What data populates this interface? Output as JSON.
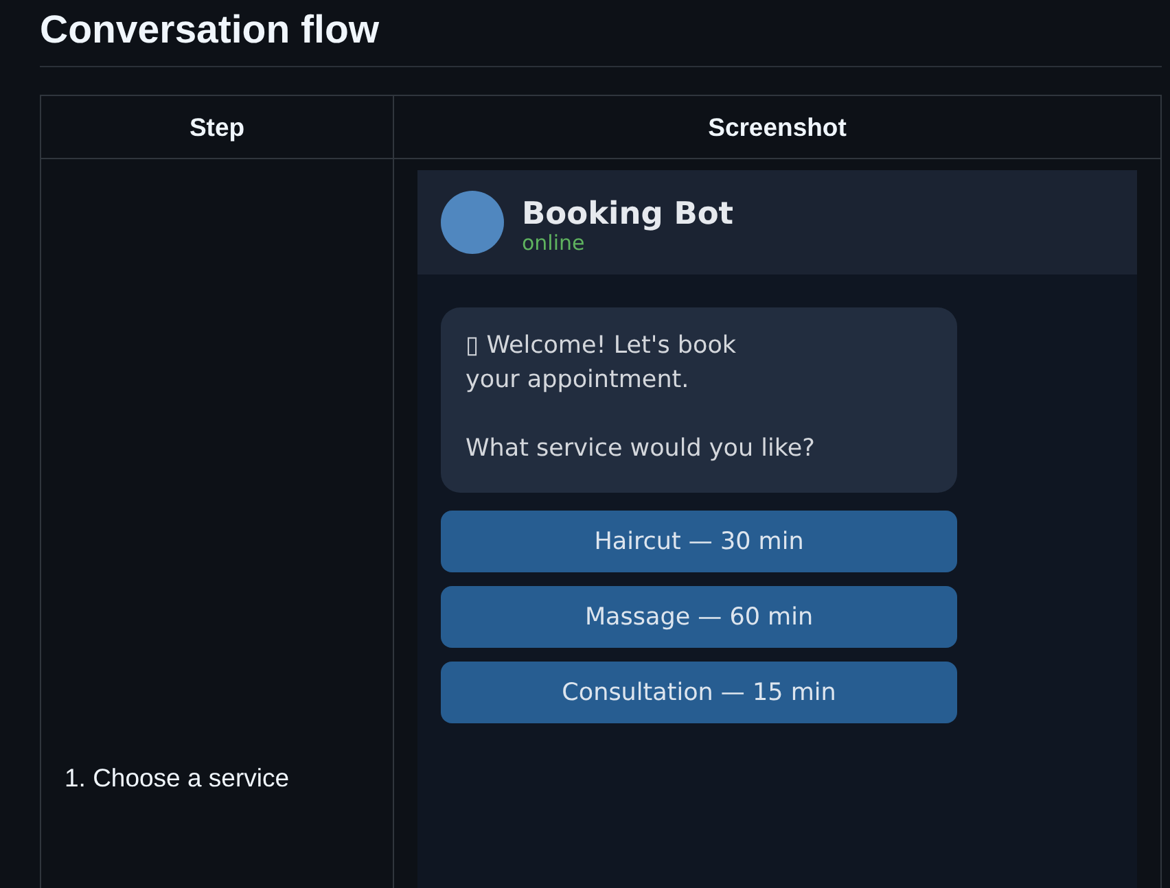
{
  "heading": "Conversation flow",
  "table": {
    "columns": [
      "Step",
      "Screenshot"
    ],
    "rows": [
      {
        "step": "1. Choose a service",
        "screenshot": {
          "bot_name": "Booking Bot",
          "status": "online",
          "messages": [
            {
              "text": "▯ Welcome! Let's book\nyour appointment.\n\nWhat service would you like?"
            }
          ],
          "options": [
            "Haircut — 30 min",
            "Massage — 60 min",
            "Consultation — 15 min"
          ]
        }
      }
    ]
  }
}
